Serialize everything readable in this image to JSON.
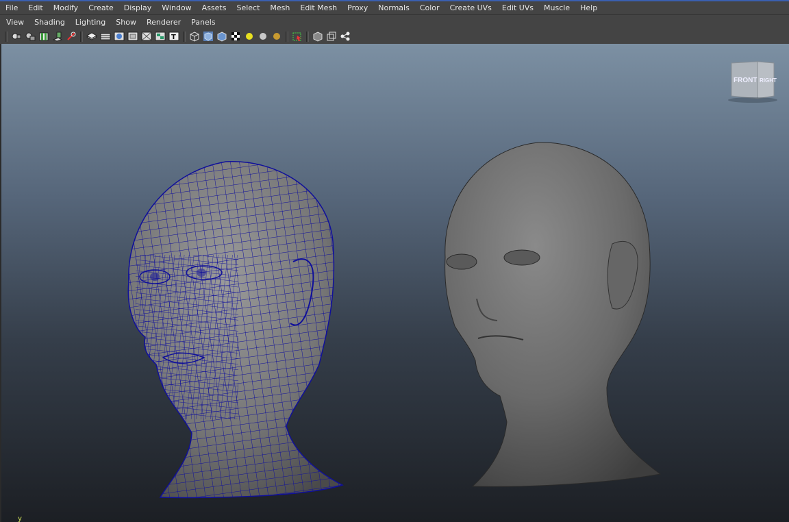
{
  "menubar": {
    "items": [
      "File",
      "Edit",
      "Modify",
      "Create",
      "Display",
      "Window",
      "Assets",
      "Select",
      "Mesh",
      "Edit Mesh",
      "Proxy",
      "Normals",
      "Color",
      "Create UVs",
      "Edit UVs",
      "Muscle",
      "Help"
    ]
  },
  "panel_menu": {
    "items": [
      "View",
      "Shading",
      "Lighting",
      "Show",
      "Renderer",
      "Panels"
    ]
  },
  "toolbar": {
    "icons": [
      "camera-select-icon",
      "camera-attributes-icon",
      "bookmarks-icon",
      "image-plane-icon",
      "grid-icon",
      "resolution-gate-icon",
      "film-gate-icon",
      "field-chart-icon",
      "safe-action-icon",
      "safe-title-icon",
      "texture-display-icon",
      "wireframe-icon",
      "smooth-shade-icon",
      "smooth-shade-selected-icon",
      "textured-icon",
      "default-light-icon",
      "all-lights-icon",
      "shadows-icon",
      "isolate-select-icon",
      "xray-icon",
      "xray-joints-icon",
      "share-icon"
    ]
  },
  "viewcube": {
    "front": "FRONT",
    "right": "RIGHT"
  },
  "axis": {
    "label": "y"
  },
  "colors": {
    "wireframe": "#10109a",
    "viewport_top": "#7c90a3",
    "viewport_bottom": "#1c1f24",
    "menu_bg": "#444444"
  }
}
